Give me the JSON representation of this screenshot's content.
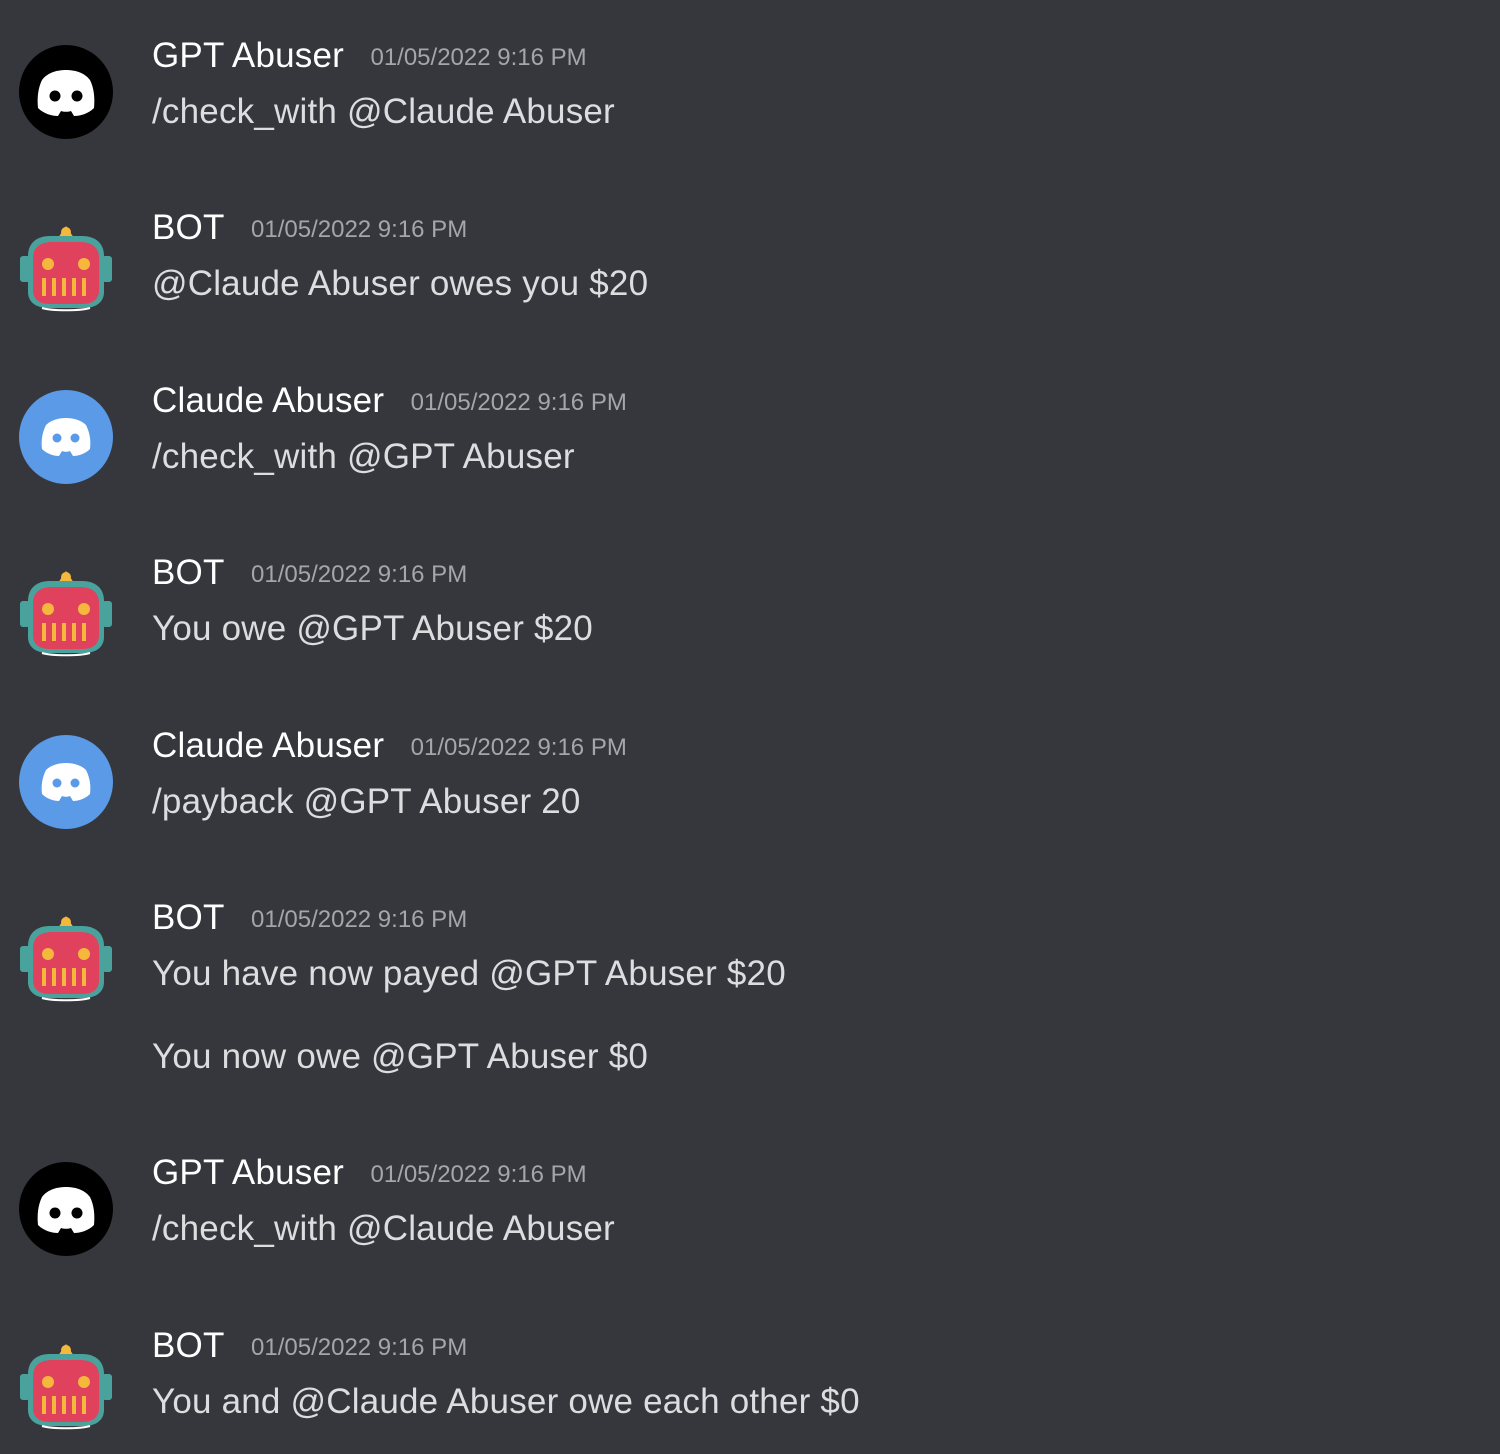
{
  "messages": [
    {
      "author": "GPT Abuser",
      "timestamp": "01/05/2022 9:16 PM",
      "avatar": "discord-black-avatar-icon",
      "lines": [
        "/check_with @Claude Abuser"
      ]
    },
    {
      "author": "BOT",
      "timestamp": "01/05/2022 9:16 PM",
      "avatar": "robot-avatar-icon",
      "lines": [
        "@Claude Abuser owes you $20"
      ]
    },
    {
      "author": "Claude Abuser",
      "timestamp": "01/05/2022 9:16 PM",
      "avatar": "discord-blue-avatar-icon",
      "lines": [
        "/check_with @GPT Abuser"
      ]
    },
    {
      "author": "BOT",
      "timestamp": "01/05/2022 9:16 PM",
      "avatar": "robot-avatar-icon",
      "lines": [
        "You owe @GPT Abuser $20"
      ]
    },
    {
      "author": "Claude Abuser",
      "timestamp": "01/05/2022 9:16 PM",
      "avatar": "discord-blue-avatar-icon",
      "lines": [
        "/payback @GPT Abuser 20"
      ]
    },
    {
      "author": "BOT",
      "timestamp": "01/05/2022 9:16 PM",
      "avatar": "robot-avatar-icon",
      "lines": [
        "You have now payed @GPT Abuser $20",
        "You now owe @GPT Abuser $0"
      ]
    },
    {
      "author": "GPT Abuser",
      "timestamp": "01/05/2022 9:16 PM",
      "avatar": "discord-black-avatar-icon",
      "lines": [
        "/check_with @Claude Abuser"
      ]
    },
    {
      "author": "BOT",
      "timestamp": "01/05/2022 9:16 PM",
      "avatar": "robot-avatar-icon",
      "lines": [
        "You and @Claude Abuser owe each other $0"
      ]
    }
  ],
  "colors": {
    "background": "#36373d",
    "author_text": "#ffffff",
    "message_text": "#dcddde",
    "timestamp_text": "#a3a6aa",
    "discord_blue": "#5b9ae6",
    "robot_red": "#e0425e",
    "robot_teal": "#4aa29c",
    "robot_yellow": "#f5b83d"
  }
}
